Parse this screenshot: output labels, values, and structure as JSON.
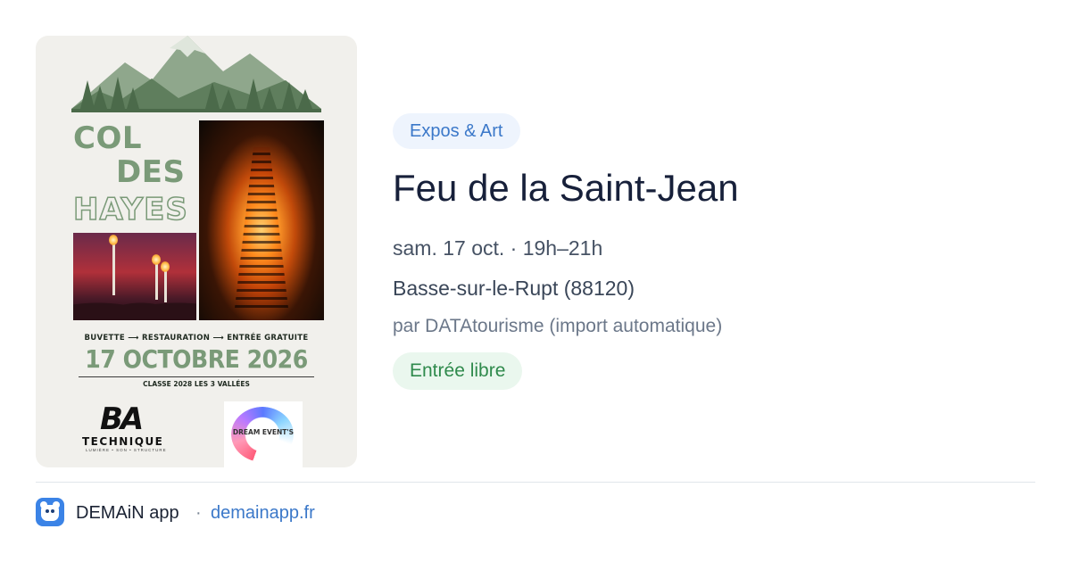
{
  "poster": {
    "line1": "COL",
    "line2": "DES",
    "line3": "HAYES",
    "services": "BUVETTE ⟶ RESTAURATION ⟶ ENTRÉE GRATUITE",
    "date": "17 OCTOBRE 2026",
    "classe": "CLASSE 2028 LES 3 VALLÉES",
    "logo_left_mark": "BA",
    "logo_left_word": "TECHNIQUE",
    "logo_left_sub": "LUMIÈRE • SON • STRUCTURE",
    "logo_right": "DREAM EVENT'S"
  },
  "event": {
    "category": "Expos & Art",
    "title": "Feu de la Saint-Jean",
    "datetime": "sam. 17 oct. · 19h–21h",
    "location": "Basse-sur-le-Rupt (88120)",
    "source": "par DATAtourisme (import automatique)",
    "price": "Entrée libre"
  },
  "footer": {
    "app_name": "DEMAiN app",
    "separator": "·",
    "link": "demainapp.fr"
  },
  "colors": {
    "accent_blue": "#3b78c9",
    "category_bg": "#eef4fd",
    "price_green": "#2f8a4c",
    "price_bg": "#eaf7ee",
    "poster_green": "#7a9a78"
  },
  "icons": {
    "app": "demain-app-icon"
  }
}
